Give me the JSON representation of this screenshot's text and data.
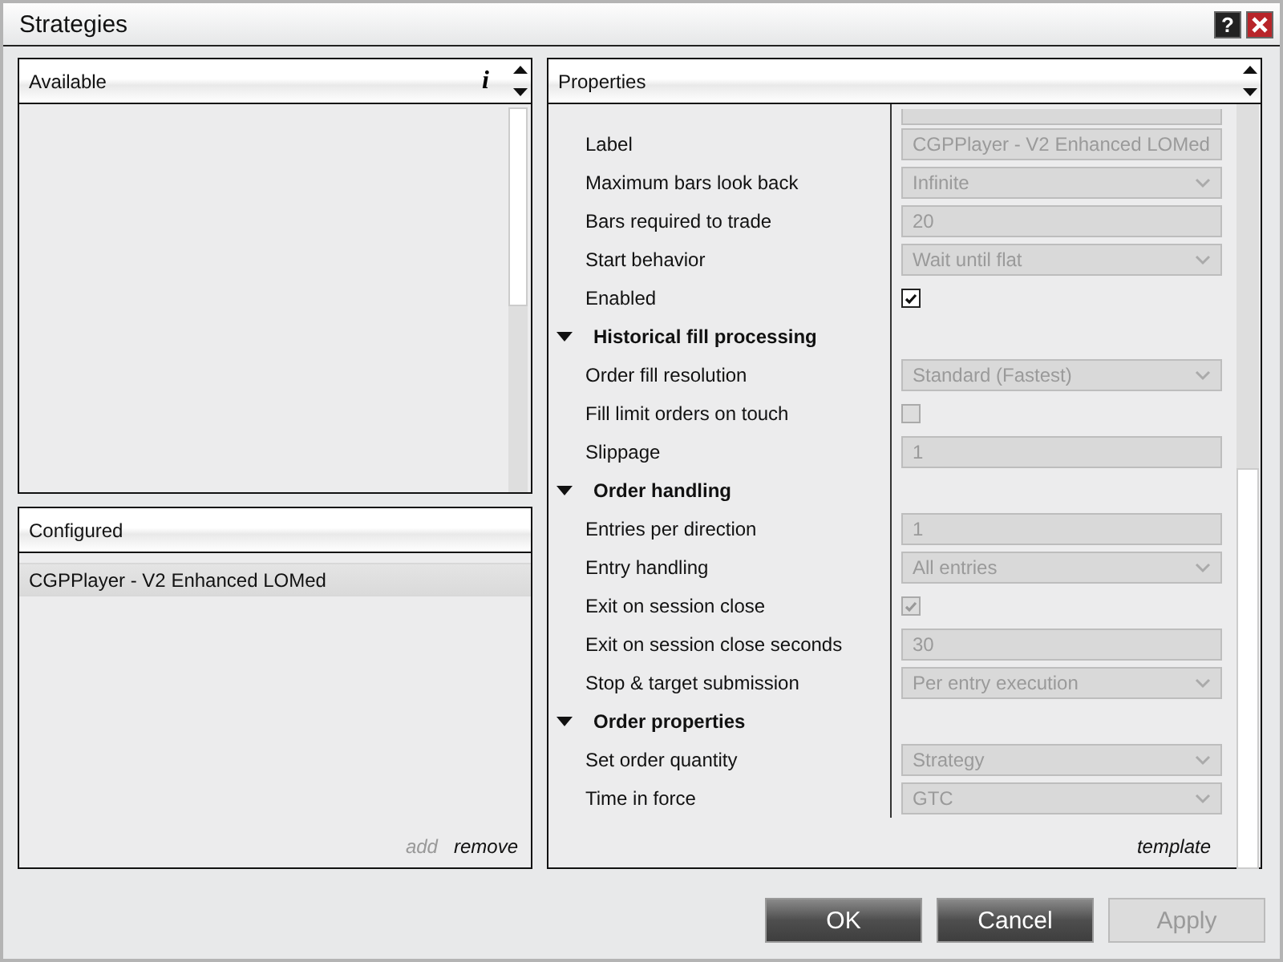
{
  "window": {
    "title": "Strategies",
    "help_button": "?"
  },
  "available": {
    "title": "Available",
    "info": "i"
  },
  "configured": {
    "title": "Configured",
    "items": [
      {
        "label": "CGPPlayer - V2 Enhanced LOMed",
        "selected": true
      }
    ],
    "actions": [
      {
        "label": "add",
        "disabled": true
      },
      {
        "label": "remove",
        "disabled": false
      }
    ]
  },
  "properties": {
    "title": "Properties",
    "rows": [
      {
        "kind": "text",
        "label": "Label",
        "value": "CGPPlayer - V2 Enhanced LOMed",
        "disabled": true
      },
      {
        "kind": "select",
        "label": "Maximum bars look back",
        "value": "Infinite",
        "disabled": true
      },
      {
        "kind": "text",
        "label": "Bars required to trade",
        "value": "20",
        "disabled": true
      },
      {
        "kind": "select",
        "label": "Start behavior",
        "value": "Wait until flat",
        "disabled": true
      },
      {
        "kind": "checkbox",
        "label": "Enabled",
        "checked": true,
        "disabled": false
      },
      {
        "kind": "category",
        "label": "Historical fill processing",
        "expanded": true
      },
      {
        "kind": "select",
        "label": "Order fill resolution",
        "value": "Standard (Fastest)",
        "disabled": true
      },
      {
        "kind": "checkbox",
        "label": "Fill limit orders on touch",
        "checked": false,
        "disabled": true
      },
      {
        "kind": "text",
        "label": "Slippage",
        "value": "1",
        "disabled": true
      },
      {
        "kind": "category",
        "label": "Order handling",
        "expanded": true
      },
      {
        "kind": "text",
        "label": "Entries per direction",
        "value": "1",
        "disabled": true
      },
      {
        "kind": "select",
        "label": "Entry handling",
        "value": "All entries",
        "disabled": true
      },
      {
        "kind": "checkbox",
        "label": "Exit on session close",
        "checked": true,
        "disabled": true
      },
      {
        "kind": "text",
        "label": "Exit on session close seconds",
        "value": "30",
        "disabled": true
      },
      {
        "kind": "select",
        "label": "Stop & target submission",
        "value": "Per entry execution",
        "disabled": true
      },
      {
        "kind": "category",
        "label": "Order properties",
        "expanded": true
      },
      {
        "kind": "select",
        "label": "Set order quantity",
        "value": "Strategy",
        "disabled": true
      },
      {
        "kind": "select",
        "label": "Time in force",
        "value": "GTC",
        "disabled": true
      }
    ],
    "template_link": "template"
  },
  "buttons": [
    {
      "label": "OK",
      "disabled": false
    },
    {
      "label": "Cancel",
      "disabled": false
    },
    {
      "label": "Apply",
      "disabled": true
    }
  ]
}
